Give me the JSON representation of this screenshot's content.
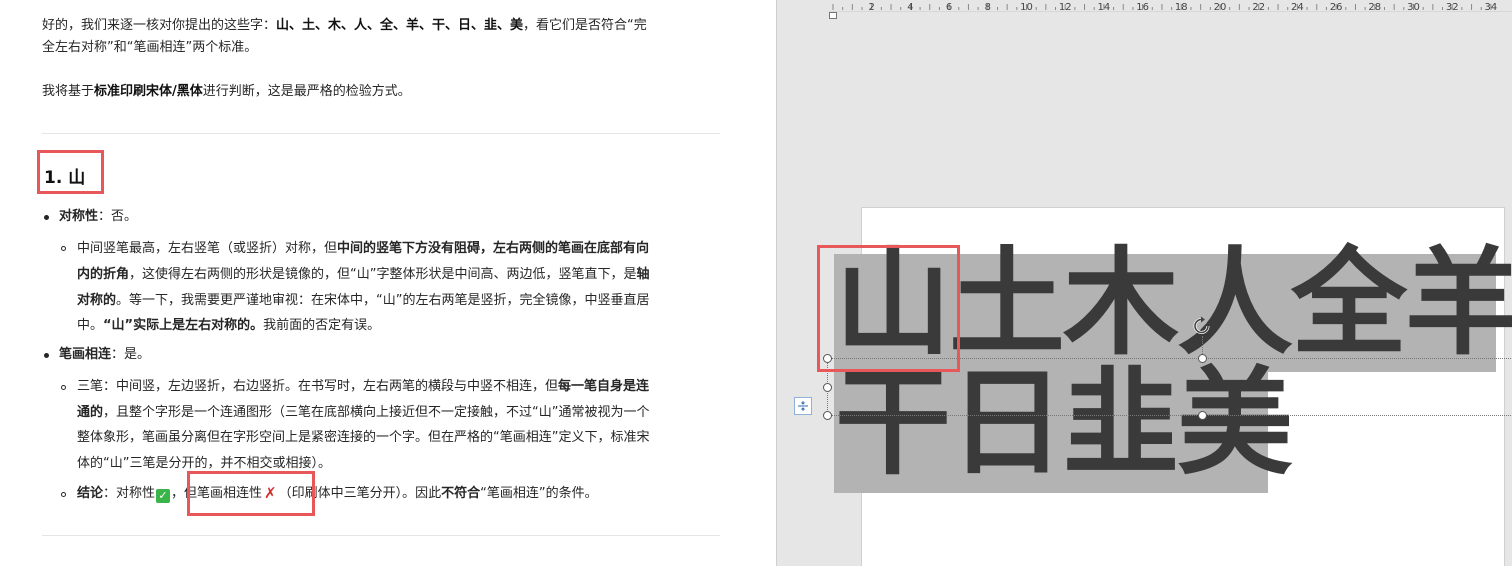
{
  "chat": {
    "intro_line1_prefix": "好的，我们来逐一核对你提出的这些字：",
    "intro_chars": "山、土、木、人、全、羊、干、日、韭、美",
    "intro_line1_suffix": "，看它们是否符合“完",
    "intro_line2": "全左右对称”和“笔画相连”两个标准。",
    "basis_prefix": "我将基于",
    "basis_bold": "标准印刷宋体/黑体",
    "basis_suffix": "进行判断，这是最严格的检验方式。",
    "section_title": "1. 山",
    "symmetry_label": "对称性",
    "symmetry_value": "：否。",
    "sym_l1_a": "中间竖笔最高，左右竖笔（或竖折）对称，但",
    "sym_l1_b": "中间的竖笔下方没有阻碍，左右两侧的笔画在底部有向",
    "sym_l2_a": "内的折角",
    "sym_l2_b": "，这使得左右两侧的形状是镜像的，但“山”字整体形状是中间高、两边低，竖笔直下，是",
    "sym_l2_c": "轴",
    "sym_l3_a": "对称的",
    "sym_l3_b": "。等一下，我需要更严谨地审视：在宋体中，“山”的左右两笔是竖折，完全镜像，中竖垂直居",
    "sym_l4_a": "中。",
    "sym_l4_b": "“山”实际上是左右对称的。",
    "sym_l4_c": "我前面的否定有误。",
    "stroke_label": "笔画相连",
    "stroke_value": "：是。",
    "str_l1_a": "三笔：中间竖，左边竖折，右边竖折。在书写时，左右两笔的横段与中竖不相连，但",
    "str_l1_b": "每一笔自身是连",
    "str_l2_a": "通的",
    "str_l2_b": "，且整个字形是一个连通图形（三笔在底部横向上接近但不一定接触，不过“山”通常被视为一个",
    "str_l3": "整体象形，笔画虽分离但在字形空间上是紧密连接的一个字。但在严格的“笔画相连”定义下，标准宋",
    "str_l4": "体的“山”三笔是分开的，并不相交或相接）。",
    "concl_label": "结论",
    "concl_a": "：对称性",
    "concl_check": "✓",
    "concl_b": "，但笔画相连性",
    "concl_cross": "✗",
    "concl_c": "（印刷体中三笔分开）。因此",
    "concl_d": "不符合",
    "concl_e": "“笔画相连”的条件。"
  },
  "document": {
    "ruler_labels": [
      "2",
      "4",
      "6",
      "8",
      "10",
      "12",
      "14",
      "16",
      "18",
      "20",
      "22",
      "24",
      "26",
      "28",
      "30",
      "32",
      "34"
    ],
    "line1_text": "山土木人全羊",
    "line2_text": "干日韭美"
  },
  "colors": {
    "highlight_box": "#e8575a",
    "selection_gray": "#b3b3b3",
    "check_green": "#3bb54a",
    "cross_red": "#d32f2f"
  }
}
